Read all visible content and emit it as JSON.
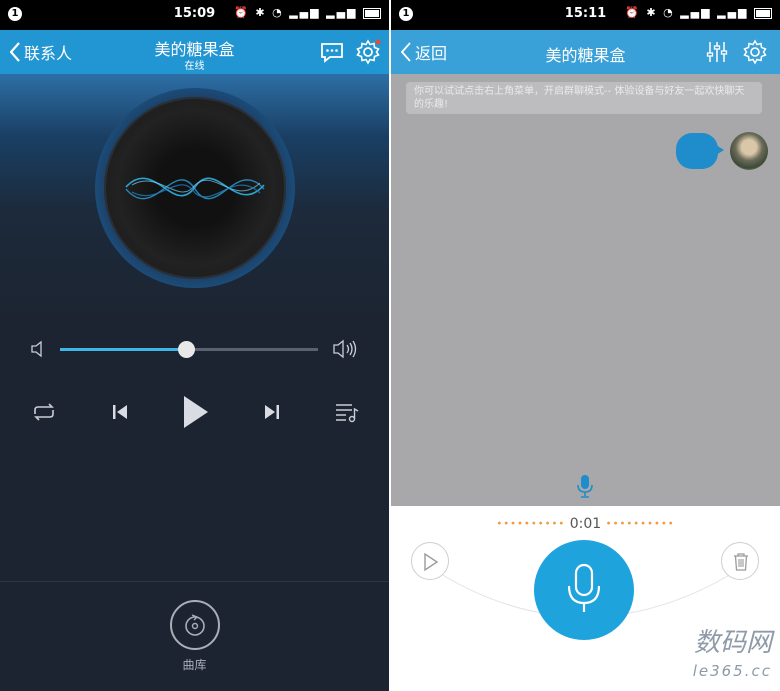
{
  "left": {
    "status": {
      "time": "15:09",
      "notif": "1"
    },
    "header": {
      "back_label": "联系人",
      "title": "美的糖果盒",
      "subtitle": "在线"
    },
    "player": {
      "progress": 0.49
    },
    "library_label": "曲库"
  },
  "right": {
    "status": {
      "time": "15:11",
      "notif": "1"
    },
    "header": {
      "back_label": "返回",
      "title": "美的糖果盒"
    },
    "hint": "你可以试试点击右上角菜单，开启群聊模式-- 体验设备与好友一起欢快聊天的乐趣!",
    "recording": {
      "timer": "0:01"
    },
    "watermark": {
      "line1": "数码网",
      "line2": "le365.cc"
    }
  },
  "colors": {
    "accent": "#2196d3",
    "record": "#1fa3dd",
    "progress": "#3fb6e6",
    "timer_dots": "#f19a3e"
  }
}
